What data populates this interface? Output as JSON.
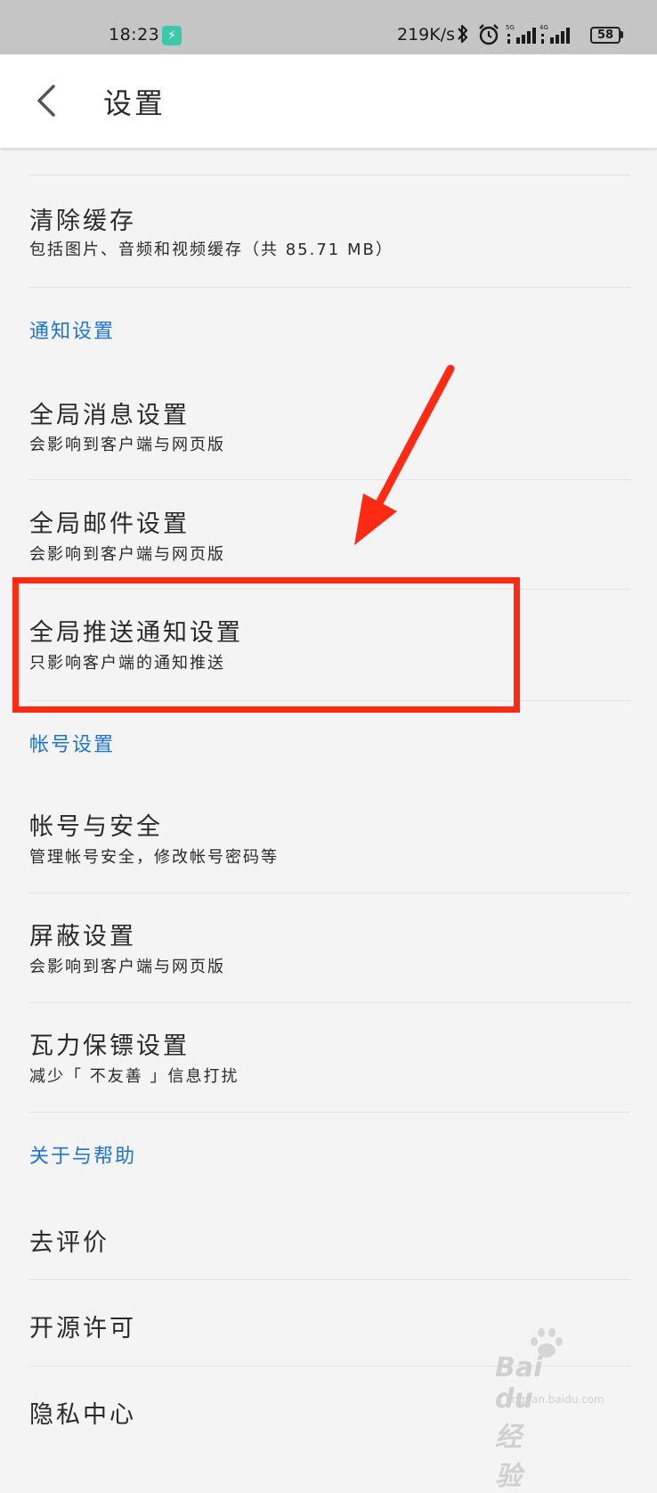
{
  "status_bar": {
    "time": "18:23",
    "net_speed": "219K/s",
    "signal1_tag": "5G",
    "signal2_tag": "4G",
    "battery": "58",
    "charge_color": "#3bc9a8"
  },
  "app_bar": {
    "back_icon": "chevron-left-icon",
    "title": "设置"
  },
  "items": {
    "clear_cache": {
      "title": "清除缓存",
      "subtitle": "包括图片、音频和视频缓存（共 85.71 MB）"
    },
    "global_message": {
      "title": "全局消息设置",
      "subtitle": "会影响到客户端与网页版"
    },
    "global_mail": {
      "title": "全局邮件设置",
      "subtitle": "会影响到客户端与网页版"
    },
    "global_push": {
      "title": "全局推送通知设置",
      "subtitle": "只影响客户端的通知推送"
    },
    "account_security": {
      "title": "帐号与安全",
      "subtitle": "管理帐号安全，修改帐号密码等"
    },
    "block_settings": {
      "title": "屏蔽设置",
      "subtitle": "会影响到客户端与网页版"
    },
    "wali_guard": {
      "title": "瓦力保镖设置",
      "subtitle": "减少「 不友善 」信息打扰"
    },
    "rate": {
      "title": "去评价"
    },
    "open_source": {
      "title": "开源许可"
    },
    "privacy": {
      "title": "隐私中心"
    }
  },
  "sections": {
    "notification": "通知设置",
    "account": "帐号设置",
    "about": "关于与帮助"
  },
  "colors": {
    "accent": "#1e73d8",
    "annotation": "#ff2a14",
    "background": "#f4f4f4"
  },
  "watermark": {
    "text": "Bai du 经验",
    "sub": "jingyan.baidu.com"
  }
}
